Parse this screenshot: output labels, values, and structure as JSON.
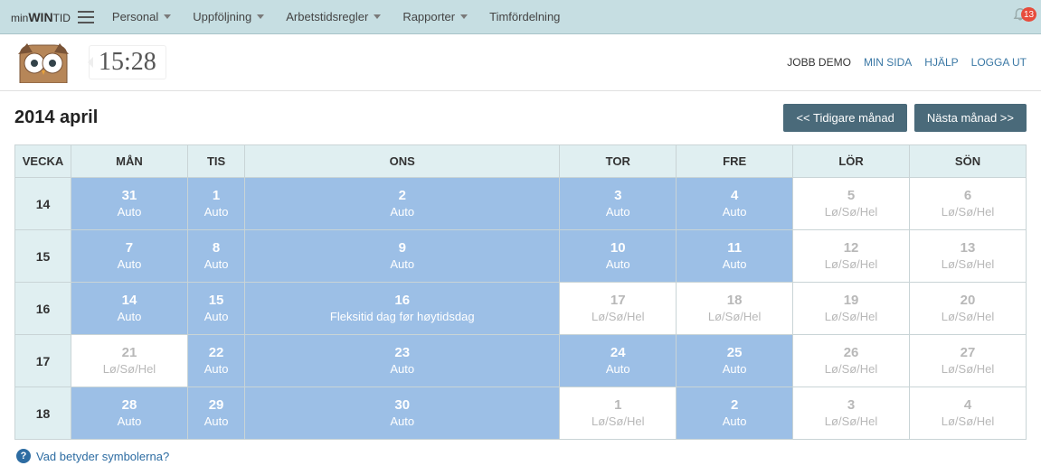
{
  "brand": {
    "pre": "min",
    "mid": "WIN",
    "post": "TID"
  },
  "nav": [
    "Personal",
    "Uppföljning",
    "Arbetstidsregler",
    "Rapporter",
    "Timfördelning"
  ],
  "nav_has_caret": [
    true,
    true,
    true,
    true,
    false
  ],
  "notif_count": "13",
  "clock": "15:28",
  "userbar": {
    "jobb": "JOBB DEMO",
    "minsida": "MIN SIDA",
    "hjalp": "HJÄLP",
    "loggaut": "LOGGA UT"
  },
  "page_title": "2014 april",
  "prev_btn": "<< Tidigare månad",
  "next_btn": "Nästa månad >>",
  "headers": [
    "VECKA",
    "MÅN",
    "TIS",
    "ONS",
    "TOR",
    "FRE",
    "LÖR",
    "SÖN"
  ],
  "weeks": [
    {
      "wk": "14",
      "days": [
        {
          "n": "31",
          "l": "Auto",
          "c": "blue"
        },
        {
          "n": "1",
          "l": "Auto",
          "c": "blue"
        },
        {
          "n": "2",
          "l": "Auto",
          "c": "blue"
        },
        {
          "n": "3",
          "l": "Auto",
          "c": "blue"
        },
        {
          "n": "4",
          "l": "Auto",
          "c": "blue"
        },
        {
          "n": "5",
          "l": "Lø/Sø/Hel",
          "c": "white"
        },
        {
          "n": "6",
          "l": "Lø/Sø/Hel",
          "c": "white"
        }
      ]
    },
    {
      "wk": "15",
      "days": [
        {
          "n": "7",
          "l": "Auto",
          "c": "blue"
        },
        {
          "n": "8",
          "l": "Auto",
          "c": "blue"
        },
        {
          "n": "9",
          "l": "Auto",
          "c": "blue"
        },
        {
          "n": "10",
          "l": "Auto",
          "c": "blue"
        },
        {
          "n": "11",
          "l": "Auto",
          "c": "blue"
        },
        {
          "n": "12",
          "l": "Lø/Sø/Hel",
          "c": "white"
        },
        {
          "n": "13",
          "l": "Lø/Sø/Hel",
          "c": "white"
        }
      ]
    },
    {
      "wk": "16",
      "days": [
        {
          "n": "14",
          "l": "Auto",
          "c": "blue"
        },
        {
          "n": "15",
          "l": "Auto",
          "c": "blue"
        },
        {
          "n": "16",
          "l": "Fleksitid dag før høytidsdag",
          "c": "blue"
        },
        {
          "n": "17",
          "l": "Lø/Sø/Hel",
          "c": "white"
        },
        {
          "n": "18",
          "l": "Lø/Sø/Hel",
          "c": "white"
        },
        {
          "n": "19",
          "l": "Lø/Sø/Hel",
          "c": "white"
        },
        {
          "n": "20",
          "l": "Lø/Sø/Hel",
          "c": "white"
        }
      ]
    },
    {
      "wk": "17",
      "days": [
        {
          "n": "21",
          "l": "Lø/Sø/Hel",
          "c": "white"
        },
        {
          "n": "22",
          "l": "Auto",
          "c": "blue"
        },
        {
          "n": "23",
          "l": "Auto",
          "c": "blue"
        },
        {
          "n": "24",
          "l": "Auto",
          "c": "blue"
        },
        {
          "n": "25",
          "l": "Auto",
          "c": "blue"
        },
        {
          "n": "26",
          "l": "Lø/Sø/Hel",
          "c": "white"
        },
        {
          "n": "27",
          "l": "Lø/Sø/Hel",
          "c": "white"
        }
      ]
    },
    {
      "wk": "18",
      "days": [
        {
          "n": "28",
          "l": "Auto",
          "c": "blue"
        },
        {
          "n": "29",
          "l": "Auto",
          "c": "blue"
        },
        {
          "n": "30",
          "l": "Auto",
          "c": "blue"
        },
        {
          "n": "1",
          "l": "Lø/Sø/Hel",
          "c": "white"
        },
        {
          "n": "2",
          "l": "Auto",
          "c": "blue"
        },
        {
          "n": "3",
          "l": "Lø/Sø/Hel",
          "c": "white"
        },
        {
          "n": "4",
          "l": "Lø/Sø/Hel",
          "c": "white"
        }
      ]
    }
  ],
  "help_text": "Vad betyder symbolerna?"
}
